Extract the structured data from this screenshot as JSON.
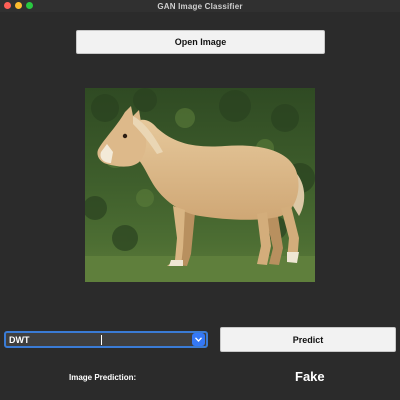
{
  "window": {
    "title": "GAN Image Classifier"
  },
  "toolbar": {
    "open_label": "Open Image"
  },
  "image": {
    "subject": "horse-photo"
  },
  "model_select": {
    "value": "DWT",
    "icon": "chevron-down-icon"
  },
  "predict": {
    "label": "Predict"
  },
  "result": {
    "label": "Image Prediction:",
    "value": "Fake"
  },
  "colors": {
    "background": "#2b2b2b",
    "accent": "#3478f6",
    "button": "#f2f2f2"
  }
}
